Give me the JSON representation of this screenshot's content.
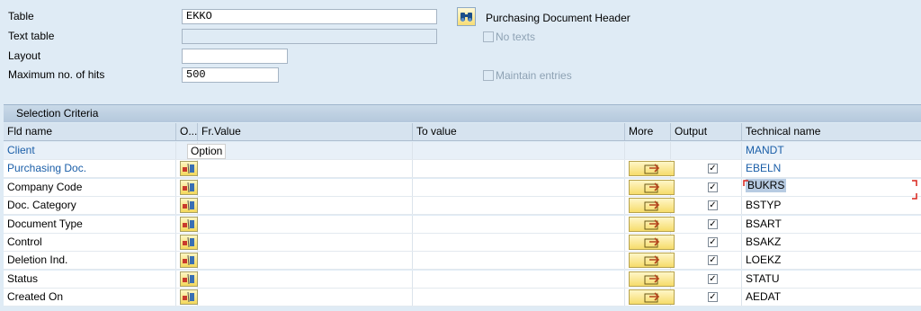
{
  "form": {
    "table_label": "Table",
    "table_value": "EKKO",
    "table_desc": "Purchasing Document Header",
    "text_table_label": "Text table",
    "text_table_value": "",
    "no_texts_label": "No texts",
    "layout_label": "Layout",
    "layout_value": "",
    "max_hits_label": "Maximum no. of hits",
    "max_hits_value": "500",
    "maintain_entries_label": "Maintain entries"
  },
  "grid": {
    "title": "Selection Criteria",
    "headers": {
      "fld_name": "Fld name",
      "option": "O...",
      "fr_value": "Fr.Value",
      "to_value": "To value",
      "more": "More",
      "output": "Output",
      "technical_name": "Technical name"
    },
    "tooltip": "Option",
    "rows": [
      {
        "name": "Client",
        "tech": "MANDT"
      },
      {
        "name": "Purchasing Doc.",
        "tech": "EBELN"
      },
      {
        "name": "Company Code",
        "tech": "BUKRS"
      },
      {
        "name": "Doc. Category",
        "tech": "BSTYP"
      },
      {
        "name": "Document Type",
        "tech": "BSART"
      },
      {
        "name": "Control",
        "tech": "BSAKZ"
      },
      {
        "name": "Deletion Ind.",
        "tech": "LOEKZ"
      },
      {
        "name": "Status",
        "tech": "STATU"
      },
      {
        "name": "Created On",
        "tech": "AEDAT"
      }
    ]
  },
  "colors": {
    "background": "#dfebf5",
    "link_blue": "#1a5ea8",
    "button_yellow": "#f6dc6b"
  },
  "icons": {
    "table_search": "binoculars-icon",
    "option": "selection-option-icon",
    "more": "multiple-selection-arrow-icon"
  }
}
